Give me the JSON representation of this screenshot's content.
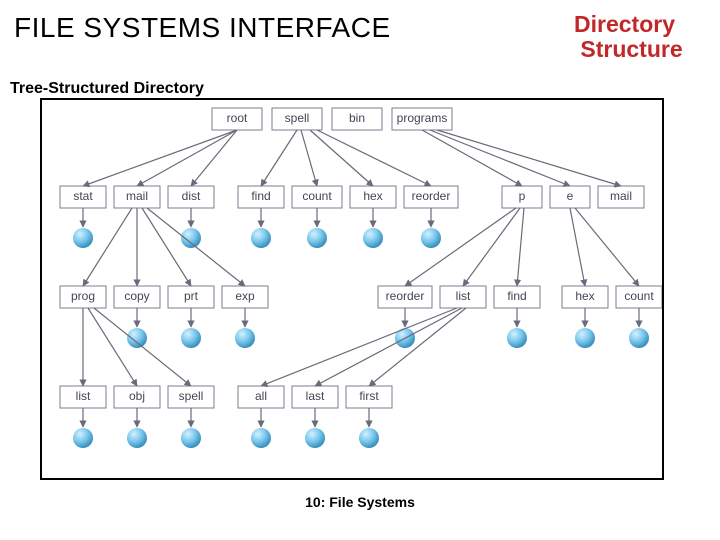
{
  "title": "FILE SYSTEMS INTERFACE",
  "topic_line1": "Directory",
  "topic_line2": "Structure",
  "subheading": "Tree-Structured Directory",
  "footer": "10: File Systems",
  "row0": {
    "root": "root",
    "spell": "spell",
    "bin": "bin",
    "programs": "programs"
  },
  "row1": {
    "stat": "stat",
    "mail": "mail",
    "dist": "dist",
    "find": "find",
    "count": "count",
    "hex": "hex",
    "reorder": "reorder",
    "p": "p",
    "e": "e",
    "mail2": "mail"
  },
  "row2": {
    "prog": "prog",
    "copy": "copy",
    "prt": "prt",
    "exp": "exp",
    "reorder": "reorder",
    "list": "list",
    "find": "find",
    "hex": "hex",
    "count": "count"
  },
  "row3": {
    "list": "list",
    "obj": "obj",
    "spell": "spell",
    "all": "all",
    "last": "last",
    "first": "first"
  }
}
